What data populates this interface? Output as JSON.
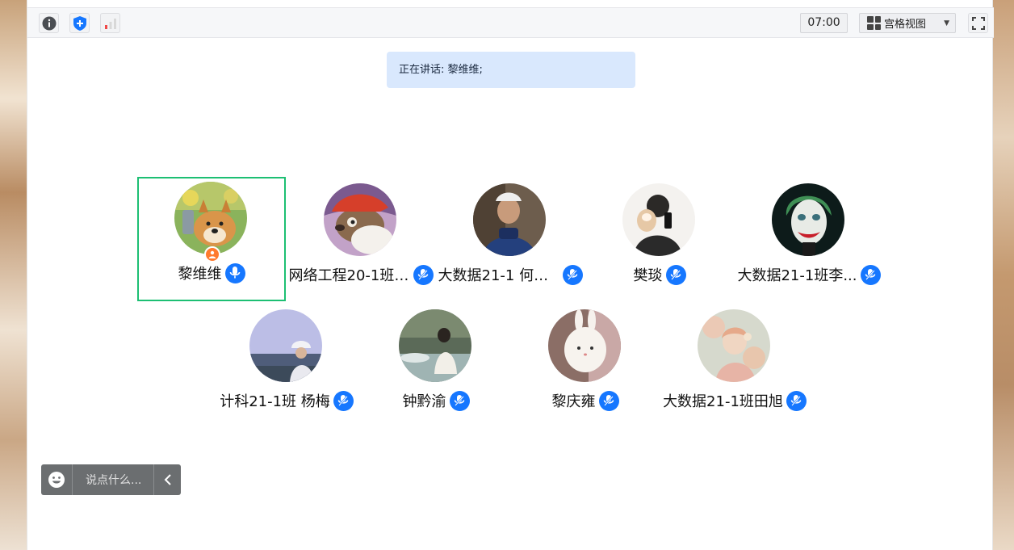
{
  "toolbar": {
    "clock": "07:00",
    "view_mode": "宫格视图"
  },
  "speaking_banner": "正在讲话: 黎维维;",
  "participants": [
    {
      "name": "黎维维",
      "avatar": "shiba-dog-photo",
      "host": true,
      "active": true
    },
    {
      "name": "网络工程20-1班 ...",
      "avatar": "jerry-mouse-cartoon"
    },
    {
      "name": "大数据21-1 何佳...",
      "avatar": "person-blue-jacket-photo"
    },
    {
      "name": "樊琰",
      "avatar": "person-holding-phone-photo"
    },
    {
      "name": "大数据21-1班李...",
      "avatar": "joker-face-photo"
    },
    {
      "name": "计科21-1班  杨梅",
      "avatar": "person-hat-landscape-photo"
    },
    {
      "name": "钟黔渝",
      "avatar": "girl-fountain-photo"
    },
    {
      "name": "黎庆雍",
      "avatar": "bunny-plush-photo"
    },
    {
      "name": "大数据21-1班田旭",
      "avatar": "pastel-illustration"
    }
  ],
  "chat": {
    "placeholder": "说点什么..."
  },
  "colors": {
    "active_border": "#1dbf73",
    "mic_blue": "#1677ff",
    "host_badge": "#ff7a2e",
    "banner_bg": "#d9e8fd"
  }
}
